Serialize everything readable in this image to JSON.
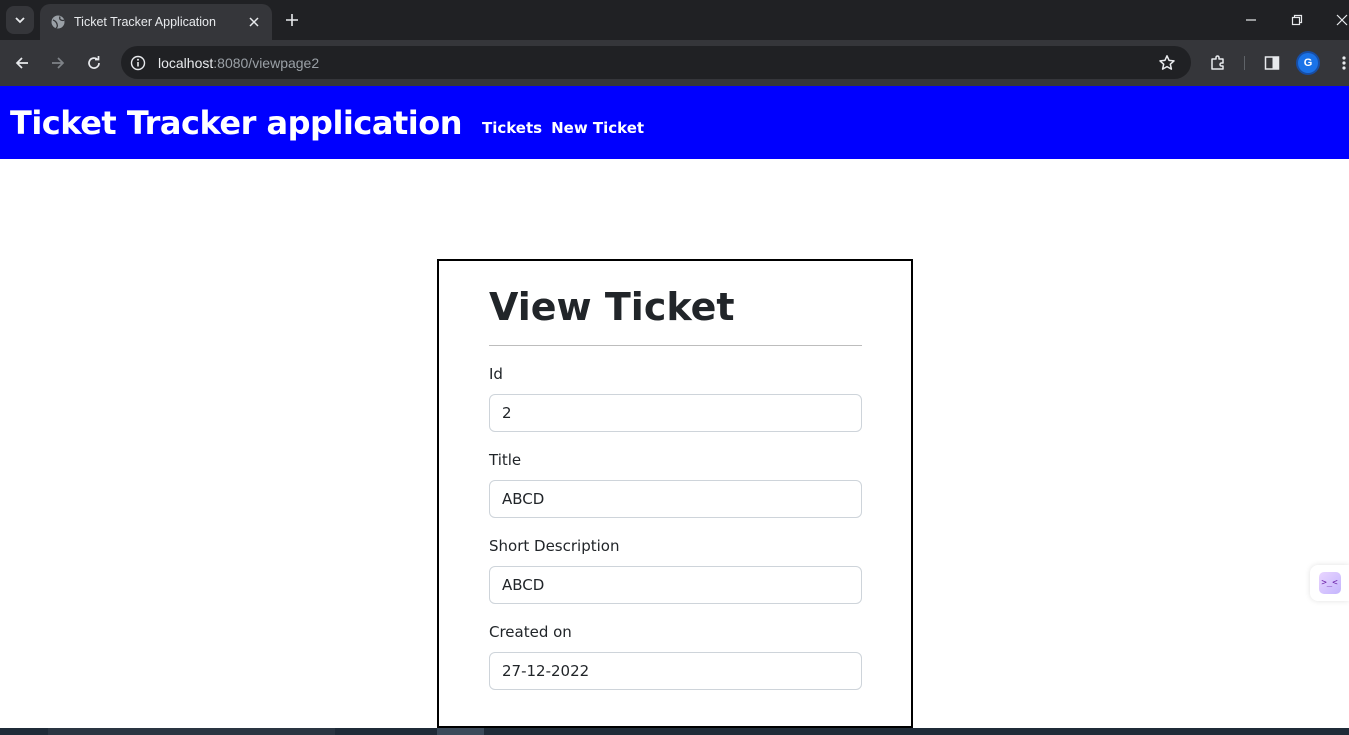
{
  "browser": {
    "tab_title": "Ticket Tracker Application",
    "url_host": "localhost",
    "url_path": ":8080/viewpage2",
    "profile_initial": "G"
  },
  "navbar": {
    "brand": "Ticket Tracker application",
    "links": [
      "Tickets",
      "New Ticket"
    ]
  },
  "ticket": {
    "heading": "View Ticket",
    "fields": [
      {
        "label": "Id",
        "value": "2"
      },
      {
        "label": "Title",
        "value": "ABCD"
      },
      {
        "label": "Short Description",
        "value": "ABCD"
      },
      {
        "label": "Created on",
        "value": "27-12-2022"
      }
    ]
  },
  "side_widget": {
    "glyph": ">_<"
  },
  "colors": {
    "navbar_bg": "#0000ff",
    "chrome_dark": "#202124",
    "chrome_toolbar": "#35363a"
  }
}
